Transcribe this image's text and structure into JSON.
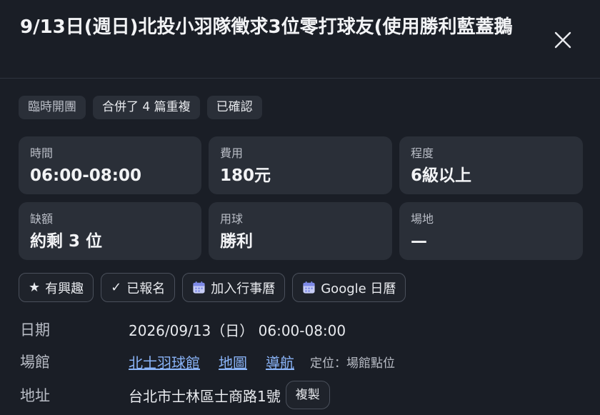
{
  "header": {
    "title": "9/13日(週日)北投小羽隊徵求3位零打球友(使用勝利藍蓋鵝",
    "close_icon": "close-icon"
  },
  "tags": [
    "臨時開團",
    "合併了 4 篇重複",
    "已確認"
  ],
  "cards": [
    {
      "label": "時間",
      "value": "06:00-08:00"
    },
    {
      "label": "費用",
      "value": "180元"
    },
    {
      "label": "程度",
      "value": "6級以上"
    },
    {
      "label": "缺額",
      "value": "約剩 3 位"
    },
    {
      "label": "用球",
      "value": "勝利"
    },
    {
      "label": "場地",
      "value": "—"
    }
  ],
  "actions": {
    "interested": {
      "icon": "star-icon",
      "glyph": "★",
      "label": "有興趣"
    },
    "signed_up": {
      "icon": "check-icon",
      "glyph": "✓",
      "label": "已報名"
    },
    "add_calendar": {
      "icon": "calendar-icon",
      "label": "加入行事曆"
    },
    "google_calendar": {
      "icon": "calendar-icon",
      "label": "Google 日曆"
    }
  },
  "info": {
    "date": {
      "label": "日期",
      "value": "2026/09/13（日） 06:00-08:00"
    },
    "venue": {
      "label": "場館",
      "name_link": "北士羽球館",
      "map_link": "地圖",
      "nav_link": "導航",
      "hint": "定位：場館點位"
    },
    "address": {
      "label": "地址",
      "value": "台北市士林區士商路1號",
      "copy_label": "複製"
    }
  },
  "colors": {
    "background": "#1a1e26",
    "card": "#2a2f38",
    "link": "#8ab4f8",
    "muted": "#b9bdc6"
  }
}
